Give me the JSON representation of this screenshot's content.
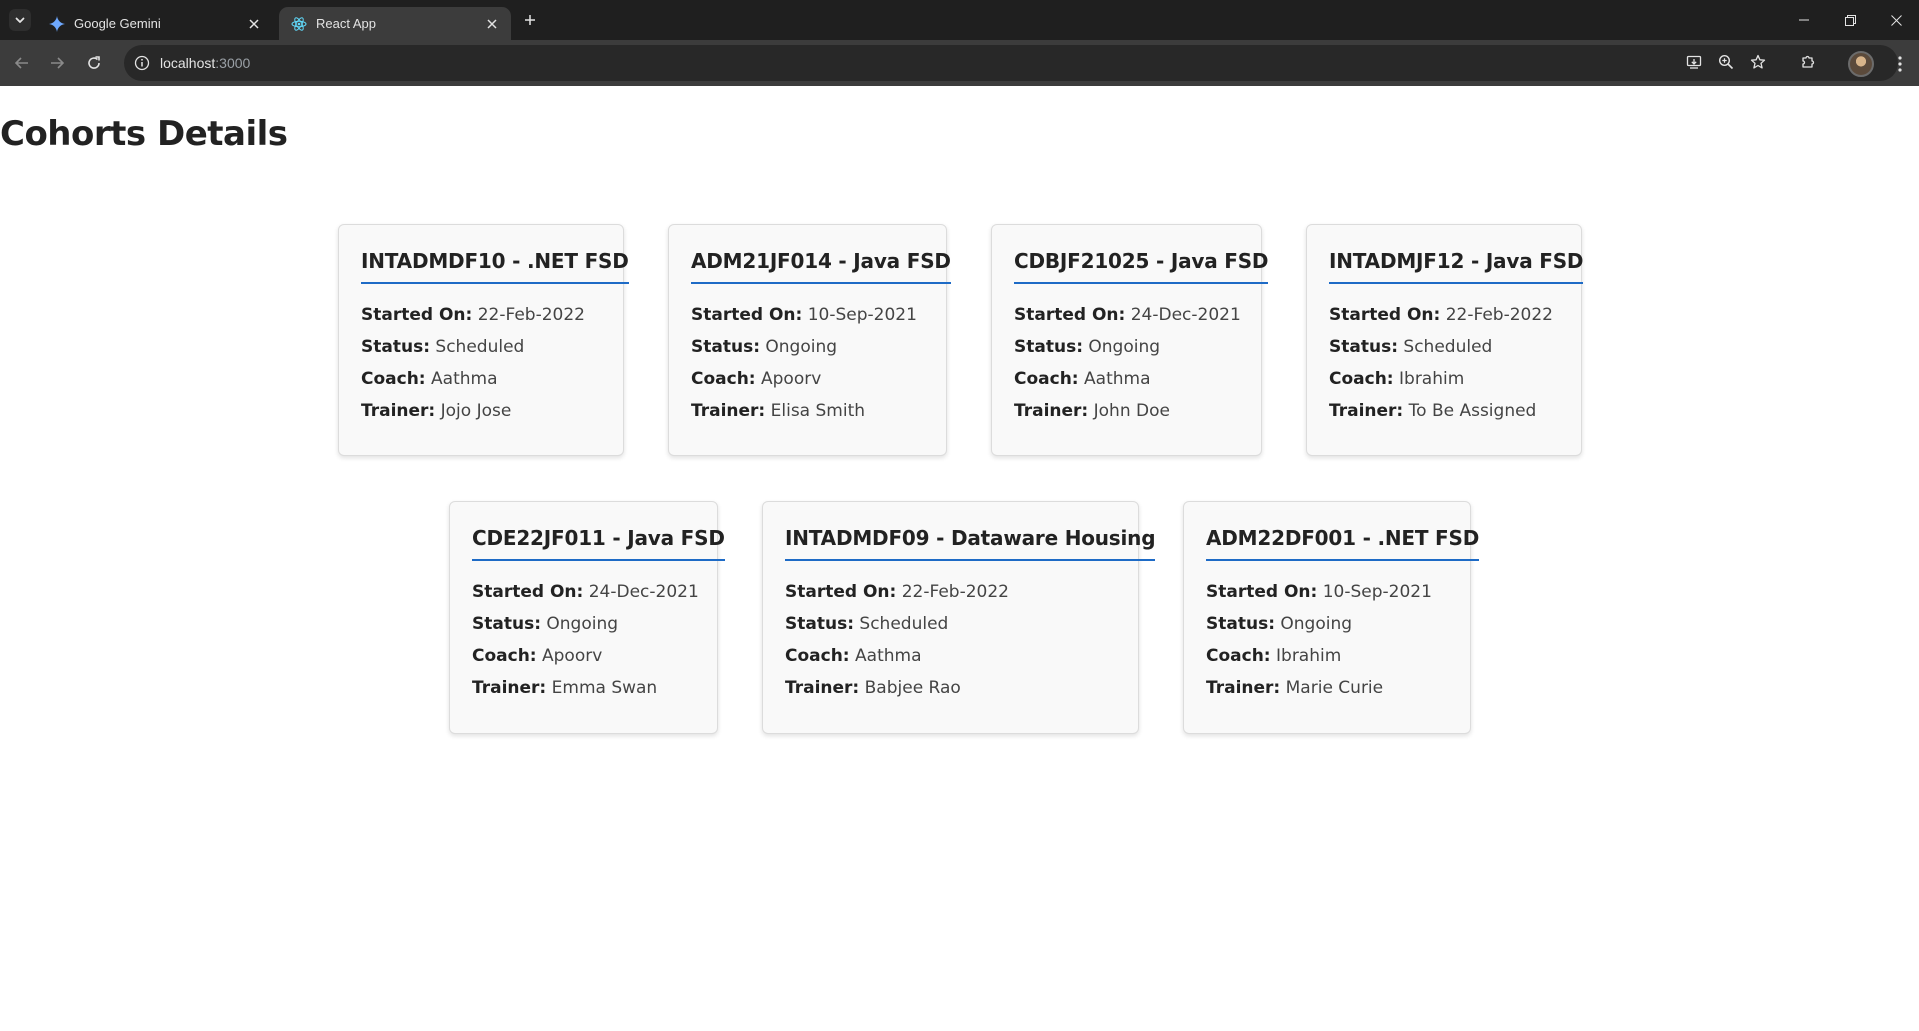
{
  "browser": {
    "tabs": [
      {
        "title": "Google Gemini",
        "icon": "gemini-icon",
        "active": false
      },
      {
        "title": "React App",
        "icon": "react-icon",
        "active": true
      }
    ],
    "address": {
      "host": "localhost",
      "port": ":3000"
    }
  },
  "page": {
    "title": "Cohorts Details",
    "labels": {
      "started": "Started On:",
      "status": "Status:",
      "coach": "Coach:",
      "trainer": "Trainer:"
    }
  },
  "cohorts": [
    {
      "title": "INTADMDF10 - .NET FSD",
      "started": "22-Feb-2022",
      "status": "Scheduled",
      "coach": "Aathma",
      "trainer": "Jojo Jose"
    },
    {
      "title": "ADM21JF014 - Java FSD",
      "started": "10-Sep-2021",
      "status": "Ongoing",
      "coach": "Apoorv",
      "trainer": "Elisa Smith"
    },
    {
      "title": "CDBJF21025 - Java FSD",
      "started": "24-Dec-2021",
      "status": "Ongoing",
      "coach": "Aathma",
      "trainer": "John Doe"
    },
    {
      "title": "INTADMJF12 - Java FSD",
      "started": "22-Feb-2022",
      "status": "Scheduled",
      "coach": "Ibrahim",
      "trainer": "To Be Assigned"
    },
    {
      "title": "CDE22JF011 - Java FSD",
      "started": "24-Dec-2021",
      "status": "Ongoing",
      "coach": "Apoorv",
      "trainer": "Emma Swan"
    },
    {
      "title": "INTADMDF09 - Dataware Housing",
      "started": "22-Feb-2022",
      "status": "Scheduled",
      "coach": "Aathma",
      "trainer": "Babjee Rao"
    },
    {
      "title": "ADM22DF001 - .NET FSD",
      "started": "10-Sep-2021",
      "status": "Ongoing",
      "coach": "Ibrahim",
      "trainer": "Marie Curie"
    }
  ],
  "colors": {
    "accent_underline": "#1e6bc6",
    "card_background": "#f9f9f9",
    "chrome_dark": "#1f1f1f"
  }
}
